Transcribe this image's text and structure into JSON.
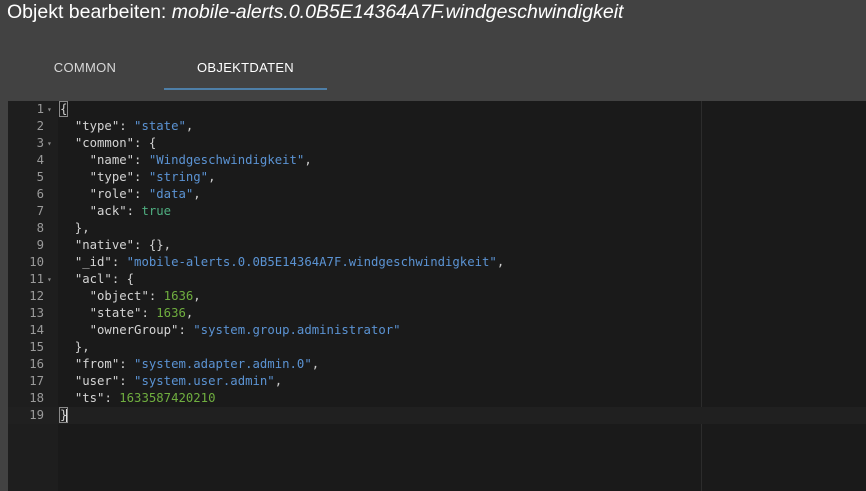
{
  "dialog": {
    "title_prefix": "Objekt bearbeiten: ",
    "object_id": "mobile-alerts.0.0B5E14364A7F.windgeschwindigkeit"
  },
  "tabs": [
    {
      "label": "COMMON",
      "active": false
    },
    {
      "label": "OBJEKTDATEN",
      "active": true
    }
  ],
  "colors": {
    "accent": "#4e7fa8",
    "string": "#5b93d3",
    "number": "#6fae3f",
    "boolean": "#4fae80"
  },
  "editor": {
    "lines": [
      {
        "n": "1",
        "fold": true,
        "tokens": [
          [
            "p",
            "{"
          ]
        ]
      },
      {
        "n": "2",
        "fold": false,
        "tokens": [
          [
            "p",
            "  "
          ],
          [
            "k",
            "\"type\""
          ],
          [
            "p",
            ": "
          ],
          [
            "s",
            "\"state\""
          ],
          [
            "p",
            ","
          ]
        ]
      },
      {
        "n": "3",
        "fold": true,
        "tokens": [
          [
            "p",
            "  "
          ],
          [
            "k",
            "\"common\""
          ],
          [
            "p",
            ": {"
          ]
        ]
      },
      {
        "n": "4",
        "fold": false,
        "tokens": [
          [
            "p",
            "    "
          ],
          [
            "k",
            "\"name\""
          ],
          [
            "p",
            ": "
          ],
          [
            "s",
            "\"Windgeschwindigkeit\""
          ],
          [
            "p",
            ","
          ]
        ]
      },
      {
        "n": "5",
        "fold": false,
        "tokens": [
          [
            "p",
            "    "
          ],
          [
            "k",
            "\"type\""
          ],
          [
            "p",
            ": "
          ],
          [
            "s",
            "\"string\""
          ],
          [
            "p",
            ","
          ]
        ]
      },
      {
        "n": "6",
        "fold": false,
        "tokens": [
          [
            "p",
            "    "
          ],
          [
            "k",
            "\"role\""
          ],
          [
            "p",
            ": "
          ],
          [
            "s",
            "\"data\""
          ],
          [
            "p",
            ","
          ]
        ]
      },
      {
        "n": "7",
        "fold": false,
        "tokens": [
          [
            "p",
            "    "
          ],
          [
            "k",
            "\"ack\""
          ],
          [
            "p",
            ": "
          ],
          [
            "b",
            "true"
          ]
        ]
      },
      {
        "n": "8",
        "fold": false,
        "tokens": [
          [
            "p",
            "  },"
          ]
        ]
      },
      {
        "n": "9",
        "fold": false,
        "tokens": [
          [
            "p",
            "  "
          ],
          [
            "k",
            "\"native\""
          ],
          [
            "p",
            ": {},"
          ]
        ]
      },
      {
        "n": "10",
        "fold": false,
        "tokens": [
          [
            "p",
            "  "
          ],
          [
            "k",
            "\"_id\""
          ],
          [
            "p",
            ": "
          ],
          [
            "s",
            "\"mobile-alerts.0.0B5E14364A7F.windgeschwindigkeit\""
          ],
          [
            "p",
            ","
          ]
        ]
      },
      {
        "n": "11",
        "fold": true,
        "tokens": [
          [
            "p",
            "  "
          ],
          [
            "k",
            "\"acl\""
          ],
          [
            "p",
            ": {"
          ]
        ]
      },
      {
        "n": "12",
        "fold": false,
        "tokens": [
          [
            "p",
            "    "
          ],
          [
            "k",
            "\"object\""
          ],
          [
            "p",
            ": "
          ],
          [
            "n",
            "1636"
          ],
          [
            "p",
            ","
          ]
        ]
      },
      {
        "n": "13",
        "fold": false,
        "tokens": [
          [
            "p",
            "    "
          ],
          [
            "k",
            "\"state\""
          ],
          [
            "p",
            ": "
          ],
          [
            "n",
            "1636"
          ],
          [
            "p",
            ","
          ]
        ]
      },
      {
        "n": "14",
        "fold": false,
        "tokens": [
          [
            "p",
            "    "
          ],
          [
            "k",
            "\"ownerGroup\""
          ],
          [
            "p",
            ": "
          ],
          [
            "s",
            "\"system.group.administrator\""
          ]
        ]
      },
      {
        "n": "15",
        "fold": false,
        "tokens": [
          [
            "p",
            "  },"
          ]
        ]
      },
      {
        "n": "16",
        "fold": false,
        "tokens": [
          [
            "p",
            "  "
          ],
          [
            "k",
            "\"from\""
          ],
          [
            "p",
            ": "
          ],
          [
            "s",
            "\"system.adapter.admin.0\""
          ],
          [
            "p",
            ","
          ]
        ]
      },
      {
        "n": "17",
        "fold": false,
        "tokens": [
          [
            "p",
            "  "
          ],
          [
            "k",
            "\"user\""
          ],
          [
            "p",
            ": "
          ],
          [
            "s",
            "\"system.user.admin\""
          ],
          [
            "p",
            ","
          ]
        ]
      },
      {
        "n": "18",
        "fold": false,
        "tokens": [
          [
            "p",
            "  "
          ],
          [
            "k",
            "\"ts\""
          ],
          [
            "p",
            ": "
          ],
          [
            "n",
            "1633587420210"
          ]
        ]
      },
      {
        "n": "19",
        "fold": false,
        "tokens": [
          [
            "p",
            "}"
          ]
        ]
      }
    ]
  }
}
